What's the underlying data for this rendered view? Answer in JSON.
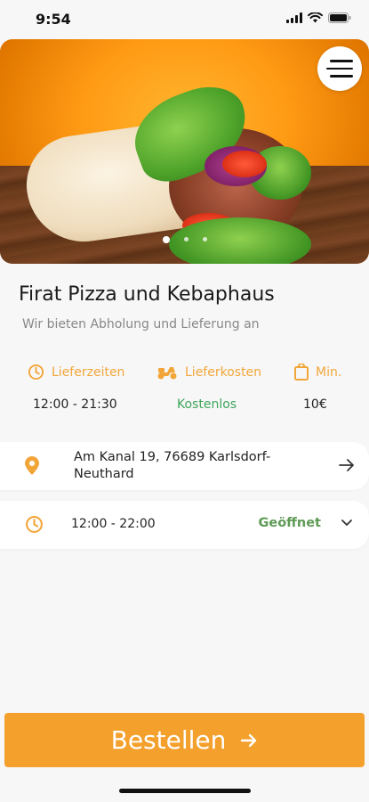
{
  "status_bar": {
    "time": "9:54"
  },
  "hero": {
    "image": "doner-wrap-photo",
    "slides": 3,
    "active_slide": 0
  },
  "restaurant": {
    "name": "Firat Pizza und Kebaphaus",
    "tagline": "Wir bieten Abholung und Lieferung an"
  },
  "info": {
    "delivery_times": {
      "label": "Lieferzeiten",
      "icon": "clock-icon",
      "value": "12:00 - 21:30"
    },
    "delivery_cost": {
      "label": "Lieferkosten",
      "icon": "scooter-icon",
      "value": "Kostenlos"
    },
    "minimum": {
      "label": "Min.",
      "icon": "shopping-bag-icon",
      "value": "10€"
    }
  },
  "address": {
    "icon": "location-pin-icon",
    "line1": "Am Kanal 19, 76689 Karlsdorf-",
    "line2": "Neuthard"
  },
  "hours": {
    "icon": "clock-icon",
    "time": "12:00 - 22:00",
    "status": "Geöffnet"
  },
  "order_button": {
    "label": "Bestellen"
  },
  "colors": {
    "accent": "#f4a02c",
    "green": "#3fa55b",
    "open_green": "#5d9a55"
  }
}
